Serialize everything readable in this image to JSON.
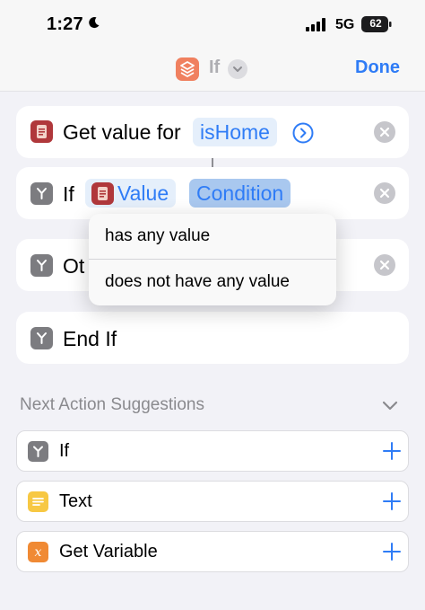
{
  "status_bar": {
    "time": "1:27",
    "network": "5G",
    "battery": "62",
    "icons": [
      "moon-icon",
      "cellular-signal-icon",
      "battery-icon"
    ]
  },
  "nav": {
    "title": "If",
    "done_label": "Done",
    "accent_color": "#2f7cf6",
    "icons": [
      "shortcut-stack-icon",
      "chevron-down-icon"
    ]
  },
  "actions": [
    {
      "label": "Get value for",
      "token": "isHome",
      "icons": [
        "dictionary-icon",
        "chevron-right-circle-icon",
        "remove-icon"
      ]
    },
    {
      "label": "If",
      "variable": "Value",
      "condition_placeholder": "Condition",
      "icons": [
        "branch-icon",
        "dictionary-icon",
        "remove-icon"
      ]
    },
    {
      "label": "Otherwise",
      "visible_label": "Ot",
      "icons": [
        "branch-icon",
        "remove-icon"
      ]
    },
    {
      "label": "End If",
      "icons": [
        "branch-icon"
      ]
    }
  ],
  "popup_menu": {
    "items": [
      "has any value",
      "does not have any value"
    ]
  },
  "suggestions": {
    "title": "Next Action Suggestions",
    "items": [
      {
        "label": "If",
        "icon": "branch-icon",
        "icon_color": "#7c7c80"
      },
      {
        "label": "Text",
        "icon": "text-icon",
        "icon_color": "#f7c843"
      },
      {
        "label": "Get Variable",
        "icon": "variable-icon",
        "icon_color": "#f08a34"
      }
    ],
    "add_icon": "plus-icon"
  }
}
